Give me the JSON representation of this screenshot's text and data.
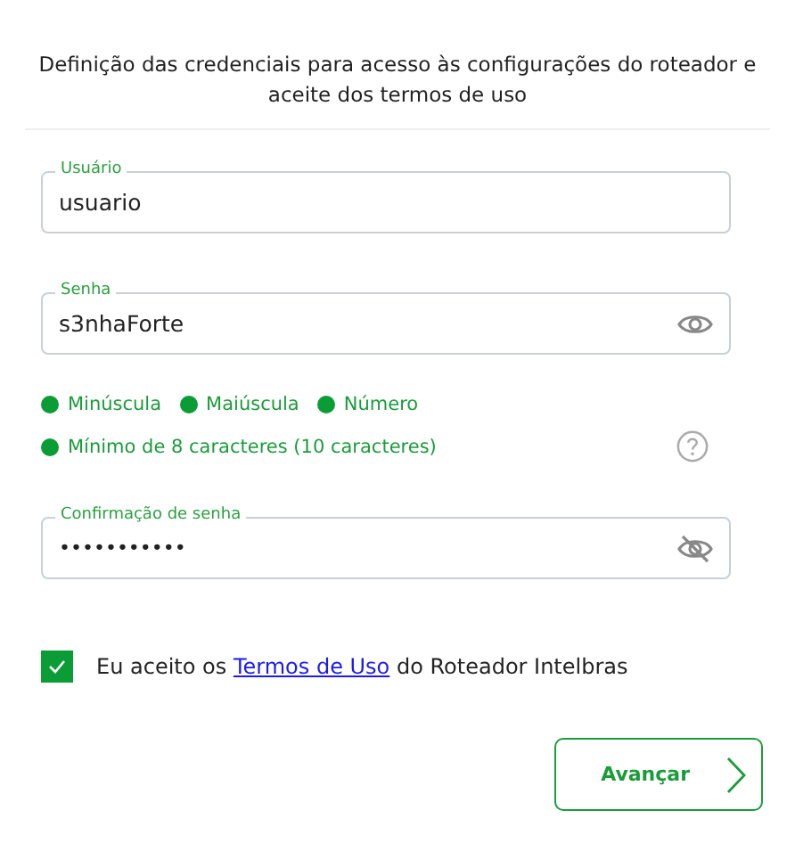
{
  "title": "Definição das credenciais para acesso às configurações do roteador e aceite dos termos de uso",
  "fields": [
    {
      "label": "Usuário",
      "value": "usuario",
      "kind": "text"
    },
    {
      "label": "Senha",
      "value": "s3nhaForte",
      "kind": "password",
      "revealed": true
    },
    {
      "label": "Confirmação de senha",
      "value": "•••••••••••",
      "kind": "password",
      "revealed": false
    }
  ],
  "requirements": [
    {
      "label": "Minúscula",
      "met": true
    },
    {
      "label": "Maiúscula",
      "met": true
    },
    {
      "label": "Número",
      "met": true
    },
    {
      "label": "Mínimo de 8 caracteres (10 caracteres)",
      "met": true
    }
  ],
  "terms": {
    "checked": true,
    "before": "Eu aceito os",
    "link": "Termos de Uso",
    "after": "do Roteador Intelbras"
  },
  "next_button": "Avançar"
}
